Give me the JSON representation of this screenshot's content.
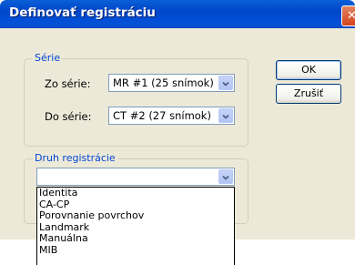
{
  "window": {
    "title": "Definovať registráciu",
    "close_glyph": "✕"
  },
  "series_group": {
    "legend": "Série",
    "from_label": "Zo série:",
    "from_value": "MR #1 (25 snímok)",
    "to_label": "Do série:",
    "to_value": "CT #2 (27 snímok)"
  },
  "buttons": {
    "ok": "OK",
    "cancel": "Zrušiť"
  },
  "registration_group": {
    "legend": "Druh registrácie",
    "selected_value": "",
    "options": [
      "Identita",
      "CA-CP",
      "Porovnanie povrchov",
      "Landmark",
      "Manuálna",
      "MIB"
    ]
  },
  "colors": {
    "title_bar": "#0046c9",
    "legend_text": "#0046d5",
    "dialog_bg": "#ece9d8"
  },
  "icons": {
    "close": "close-icon",
    "dropdown": "chevron-down-icon"
  }
}
